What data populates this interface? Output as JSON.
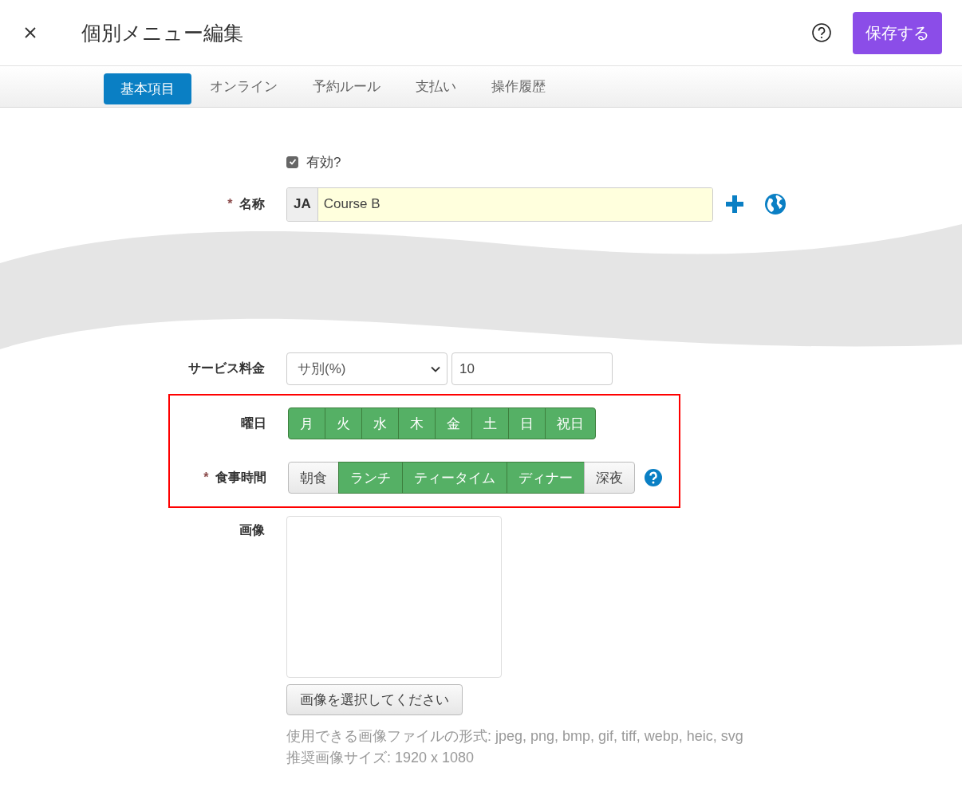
{
  "header": {
    "title": "個別メニュー編集",
    "save": "保存する"
  },
  "tabs": [
    {
      "label": "基本項目",
      "selected": true
    },
    {
      "label": "オンライン",
      "selected": false
    },
    {
      "label": "予約ルール",
      "selected": false
    },
    {
      "label": "支払い",
      "selected": false
    },
    {
      "label": "操作履歴",
      "selected": false
    }
  ],
  "form": {
    "enabled": {
      "label": "有効?",
      "checked": true
    },
    "name": {
      "label": "名称",
      "required_mark": "*",
      "language": "JA",
      "value": "Course B"
    },
    "service_charge": {
      "label": "サービス料金",
      "select": "サ別(%)",
      "value": "10"
    },
    "weekdays": {
      "label": "曜日",
      "options": [
        {
          "label": "月",
          "selected": true
        },
        {
          "label": "火",
          "selected": true
        },
        {
          "label": "水",
          "selected": true
        },
        {
          "label": "木",
          "selected": true
        },
        {
          "label": "金",
          "selected": true
        },
        {
          "label": "土",
          "selected": true
        },
        {
          "label": "日",
          "selected": true
        },
        {
          "label": "祝日",
          "selected": true
        }
      ]
    },
    "meal_times": {
      "label": "食事時間",
      "required_mark": "*",
      "options": [
        {
          "label": "朝食",
          "selected": false
        },
        {
          "label": "ランチ",
          "selected": true
        },
        {
          "label": "ティータイム",
          "selected": true
        },
        {
          "label": "ディナー",
          "selected": true
        },
        {
          "label": "深夜",
          "selected": false
        }
      ]
    },
    "image": {
      "label": "画像",
      "button": "画像を選択してください",
      "hints": [
        "使用できる画像ファイルの形式: jpeg, png, bmp, gif, tiff, webp, heic, svg",
        "推奨画像サイズ: 1920 x 1080"
      ]
    }
  }
}
